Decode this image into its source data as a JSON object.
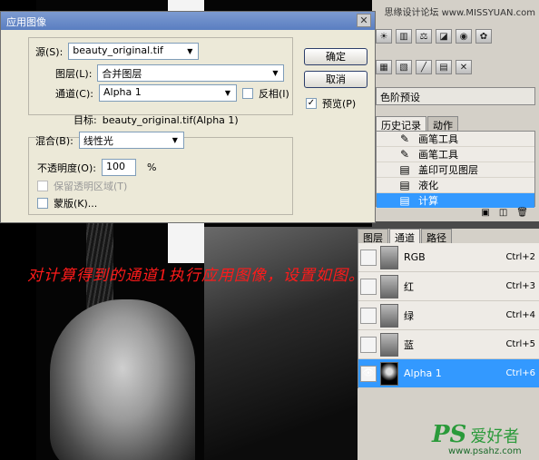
{
  "topbar": {
    "watermark": "思缘设计论坛 www.MISSYUAN.com"
  },
  "dialog": {
    "title": "应用图像",
    "source_label": "源(S):",
    "source_value": "beauty_original.tif",
    "layer_label": "图层(L):",
    "layer_value": "合并图层",
    "channel_label": "通道(C):",
    "channel_value": "Alpha 1",
    "invert_label": "反相(I)",
    "invert_checked": false,
    "target_label": "目标:",
    "target_value": "beauty_original.tif(Alpha 1)",
    "blend_label": "混合(B):",
    "blend_value": "线性光",
    "opacity_label": "不透明度(O):",
    "opacity_value": "100",
    "opacity_unit": "%",
    "preserve_label": "保留透明区域(T)",
    "mask_label": "蒙版(K)...",
    "ok_button": "确定",
    "cancel_button": "取消",
    "preview_label": "预览(P)",
    "preview_checked": true
  },
  "adjustments": {
    "preset_label": "色阶预设"
  },
  "history": {
    "tabs": [
      "历史记录",
      "动作"
    ],
    "items": [
      {
        "label": "画笔工具",
        "icon": "brush-icon"
      },
      {
        "label": "画笔工具",
        "icon": "brush-icon"
      },
      {
        "label": "盖印可见图层",
        "icon": "doc-icon"
      },
      {
        "label": "液化",
        "icon": "doc-icon"
      },
      {
        "label": "计算",
        "icon": "doc-icon"
      }
    ]
  },
  "channels": {
    "tabs": [
      "图层",
      "通道",
      "路径"
    ],
    "rows": [
      {
        "name": "RGB",
        "shortcut": "Ctrl+2"
      },
      {
        "name": "红",
        "shortcut": "Ctrl+3"
      },
      {
        "name": "绿",
        "shortcut": "Ctrl+4"
      },
      {
        "name": "蓝",
        "shortcut": "Ctrl+5"
      },
      {
        "name": "Alpha 1",
        "shortcut": "Ctrl+6"
      }
    ]
  },
  "annotation": "对计算得到的通道1执行应用图像，设置如图。",
  "watermark": {
    "logo": "PS",
    "cn": "爱好者",
    "url": "www.psahz.com"
  },
  "colors": {
    "selection": "#3399ff",
    "annotation": "#ff1a1a",
    "watermark": "#2a9a3a"
  }
}
